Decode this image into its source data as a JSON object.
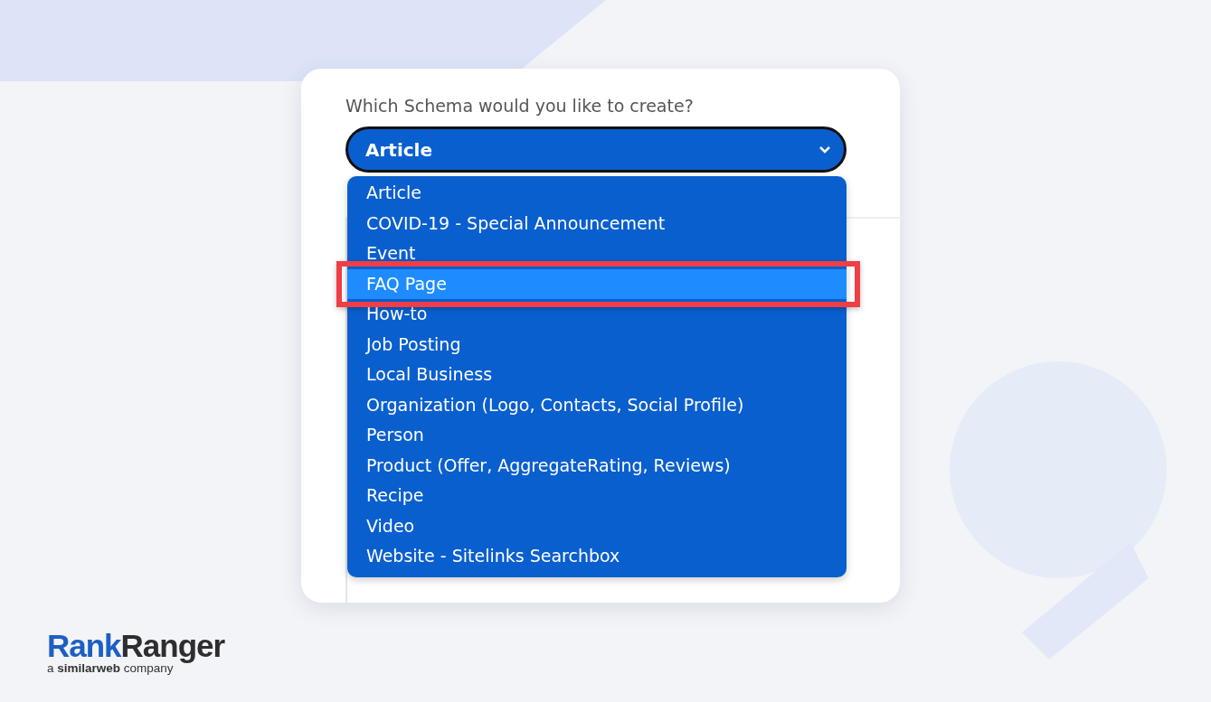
{
  "form": {
    "label": "Which Schema would you like to create?",
    "select": {
      "value": "Article",
      "expanded": true
    },
    "options": [
      {
        "label": "Article",
        "selected": false
      },
      {
        "label": "COVID-19 - Special Announcement",
        "selected": false
      },
      {
        "label": "Event",
        "selected": false
      },
      {
        "label": "FAQ Page",
        "selected": true
      },
      {
        "label": "How-to",
        "selected": false
      },
      {
        "label": "Job Posting",
        "selected": false
      },
      {
        "label": "Local Business",
        "selected": false
      },
      {
        "label": "Organization (Logo, Contacts, Social Profile)",
        "selected": false
      },
      {
        "label": "Person",
        "selected": false
      },
      {
        "label": "Product (Offer, AggregateRating, Reviews)",
        "selected": false
      },
      {
        "label": "Recipe",
        "selected": false
      },
      {
        "label": "Video",
        "selected": false
      },
      {
        "label": "Website - Sitelinks Searchbox",
        "selected": false
      }
    ]
  },
  "logo": {
    "brand_first": "Rank",
    "brand_second": "Ranger",
    "tagline": "a **similarweb** company"
  }
}
